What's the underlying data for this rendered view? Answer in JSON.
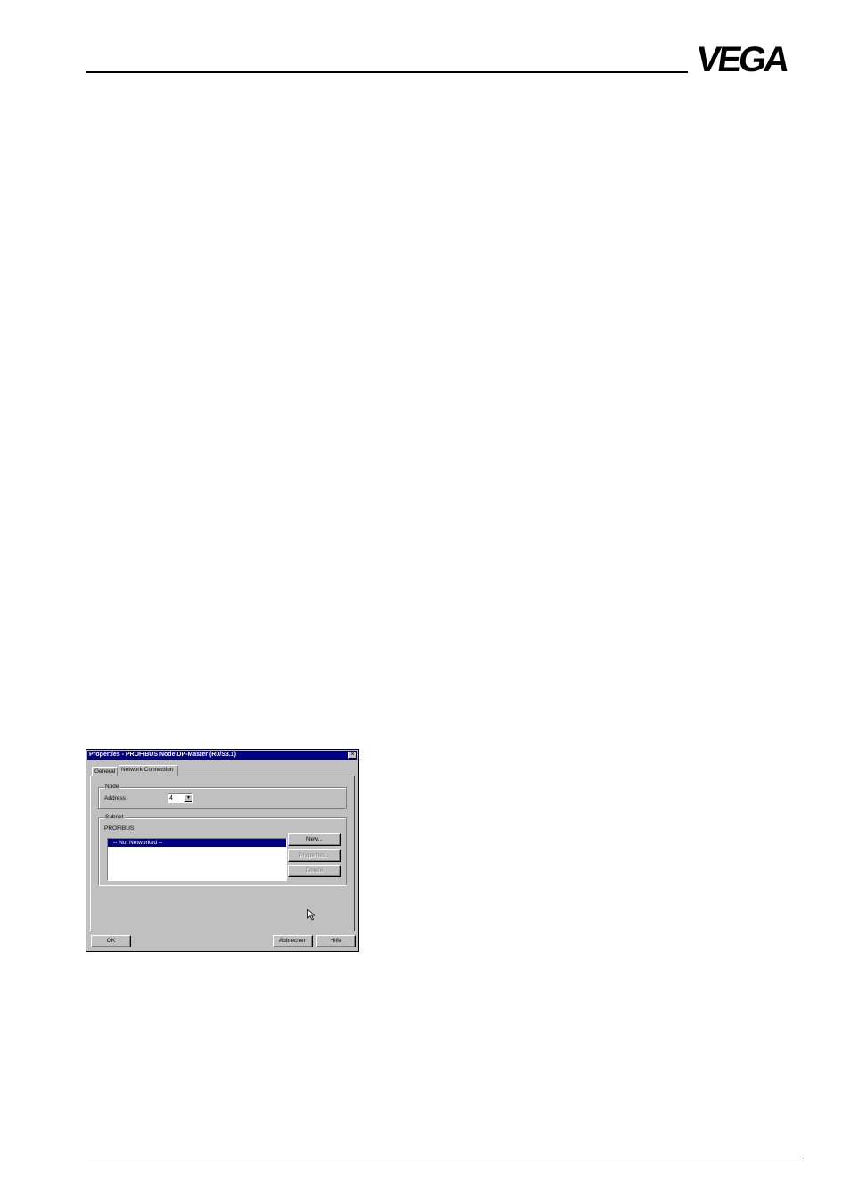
{
  "header": {
    "logo_text": "VEGA"
  },
  "dialog": {
    "title": "Properties - PROFIBUS Node  DP-Master (R0/S3.1)",
    "close_glyph": "×",
    "tabs": [
      {
        "label": "General",
        "active": false
      },
      {
        "label": "Network Connection",
        "active": true
      }
    ],
    "node": {
      "group_label": "Node",
      "address_label": "Address",
      "address_value": "4"
    },
    "subnet": {
      "group_label": "Subnet",
      "type_label": "PROFIBUS:",
      "items": [
        "-- Not Networked --"
      ],
      "selected_item": "-- Not Networked --",
      "new_label": "New...",
      "properties_label": "Properties...",
      "delete_label": "Delete"
    },
    "ok_label": "OK",
    "cancel_label": "Abbrechen",
    "help_label": "Hilfe"
  }
}
